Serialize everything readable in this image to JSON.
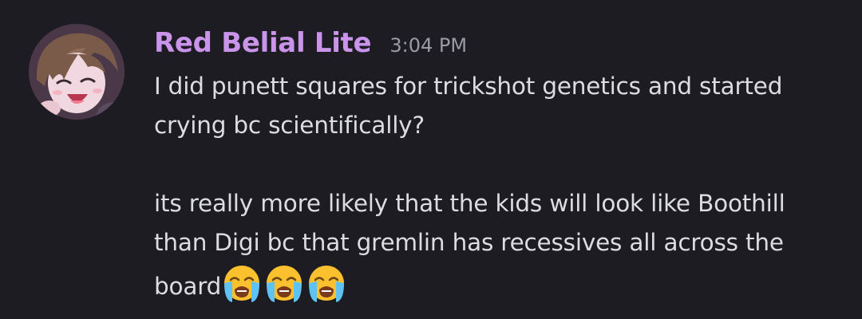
{
  "message": {
    "author": "Red Belial Lite",
    "timestamp": "3:04 PM",
    "paragraph1": {
      "line1": "I did punett squares for trickshot genetics and started",
      "line2": "crying bc scientifically?"
    },
    "paragraph2": {
      "line1": "its really more likely that the kids will look like Boothill",
      "line2": "than Digi bc that gremlin has recessives all across the",
      "line3": "board"
    },
    "emojis": [
      "loudly-crying-face",
      "loudly-crying-face",
      "loudly-crying-face"
    ]
  },
  "colors": {
    "background": "#1c1c22",
    "username": "#c994ea",
    "timestamp": "#9a9ca3",
    "text": "#dcdde1",
    "emoji_face": "#fbc02d",
    "emoji_tears": "#5ec2f2"
  }
}
